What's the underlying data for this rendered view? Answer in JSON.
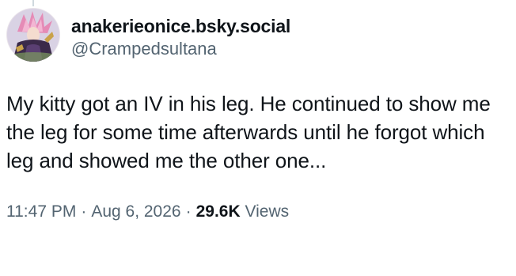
{
  "tweet": {
    "display_name": "anakerieonice.bsky.social",
    "handle": "@Crampedsultana",
    "text": "My kitty got an IV in his leg. He continued to show me the leg for some time afterwards until he forgot which leg and showed me the other one...",
    "time": "11:47 PM",
    "separator": "·",
    "date": "Aug 6, 2026",
    "views_count": "29.6K",
    "views_label": "Views"
  },
  "colors": {
    "primary_text": "#0f1419",
    "secondary_text": "#536471",
    "thread_line": "#cfd9de"
  },
  "icons": {
    "avatar": "profile-avatar"
  }
}
